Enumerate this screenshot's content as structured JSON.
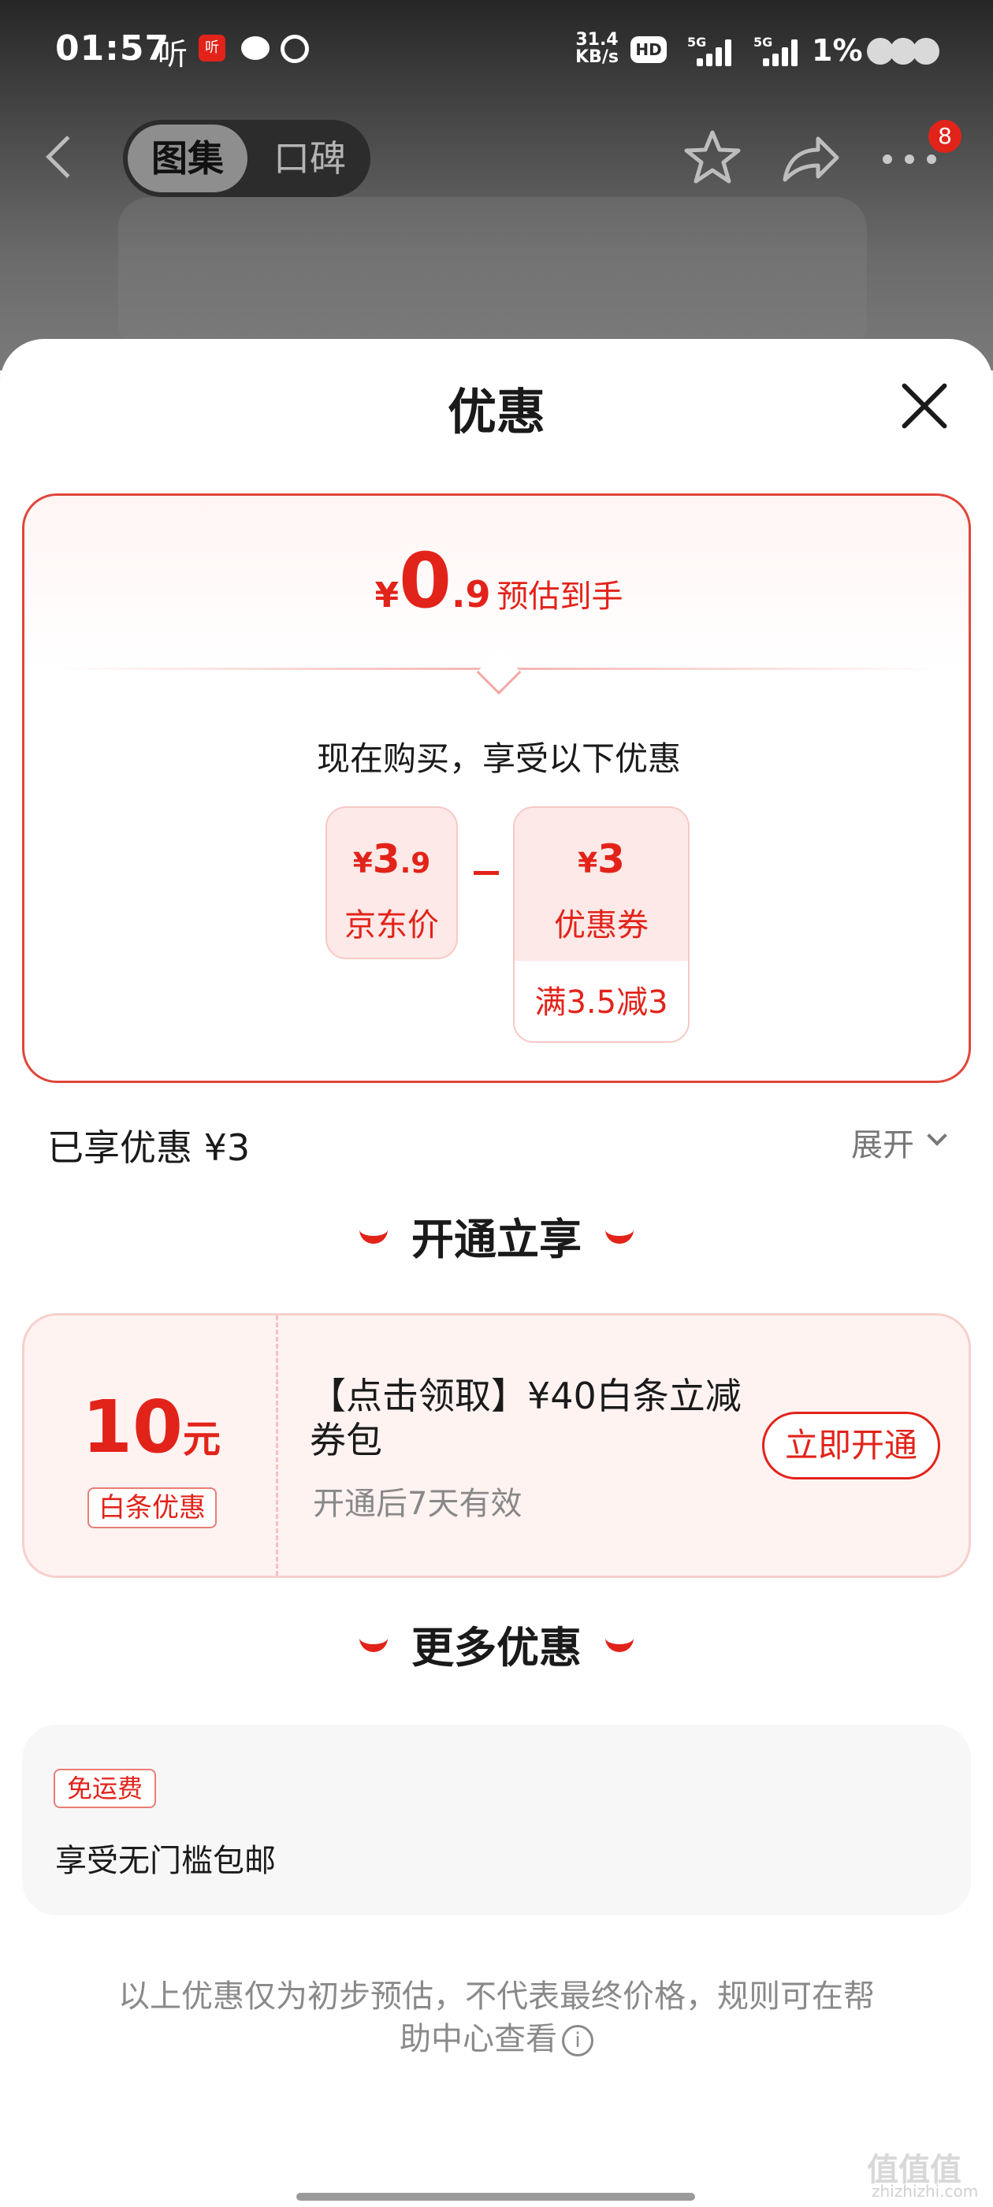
{
  "status": {
    "time": "01:57",
    "ting": "听",
    "app_badge": "听",
    "speed_value": "31.4",
    "speed_unit": "KB/s",
    "hd": "HD",
    "net1": "5G",
    "net2": "5G",
    "battery": "1%"
  },
  "nav": {
    "tab_active": "图集",
    "tab_inactive": "口碑",
    "badge_count": "8"
  },
  "sheet": {
    "title": "优惠"
  },
  "estimate": {
    "currency": "¥",
    "integer": "0",
    "decimal": ".9",
    "label": "预估到手"
  },
  "purchase_note": "现在购买，享受以下优惠",
  "jd_price": {
    "currency": "¥",
    "integer": "3",
    "decimal": ".9",
    "label": "京东价"
  },
  "coupon": {
    "currency": "¥",
    "amount": "3",
    "label": "优惠券",
    "condition": "满3.5减3"
  },
  "enjoyed": {
    "text": "已享优惠 ¥3",
    "expand": "展开"
  },
  "section_vip": {
    "title": "开通立享"
  },
  "vip_offer": {
    "amount": "10",
    "unit": "元",
    "tag": "白条优惠",
    "title": "【点击领取】¥40白条立减券包",
    "subtitle": "开通后7天有效",
    "button": "立即开通"
  },
  "section_more": {
    "title": "更多优惠"
  },
  "shipping": {
    "tag": "免运费",
    "desc": "享受无门槛包邮"
  },
  "disclaimer": "以上优惠仅为初步预估，不代表最终价格，规则可在帮助中心查看",
  "watermark": {
    "main": "值值值",
    "sub": "zhizhizhi.com"
  }
}
